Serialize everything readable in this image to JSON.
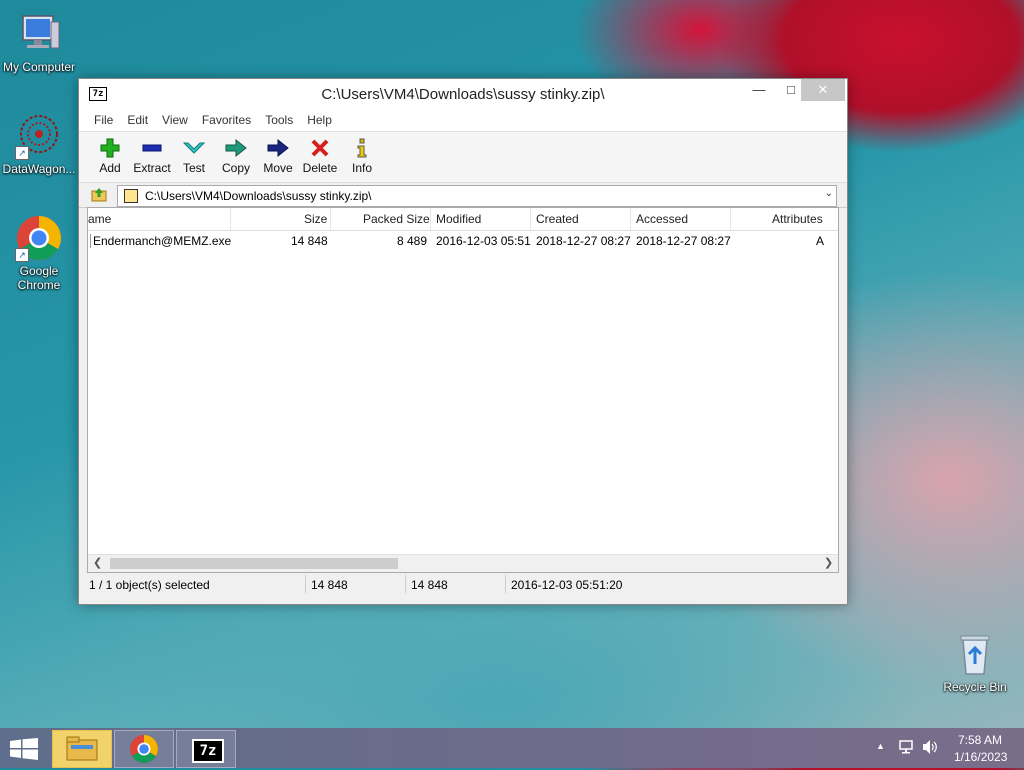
{
  "desktop": {
    "icons": [
      {
        "label": "My Computer"
      },
      {
        "label": "DataWagon..."
      },
      {
        "label": "Google Chrome"
      },
      {
        "label": "Recycle Bin"
      }
    ]
  },
  "window": {
    "title": "C:\\Users\\VM4\\Downloads\\sussy stinky.zip\\",
    "app_icon_text": "7z",
    "min_glyph": "—",
    "max_glyph": "□",
    "close_glyph": "✕",
    "menu": [
      "File",
      "Edit",
      "View",
      "Favorites",
      "Tools",
      "Help"
    ],
    "toolbar": [
      {
        "label": "Add",
        "icon": "plus-icon"
      },
      {
        "label": "Extract",
        "icon": "minus-icon"
      },
      {
        "label": "Test",
        "icon": "check-down-icon"
      },
      {
        "label": "Copy",
        "icon": "arrow-right-icon"
      },
      {
        "label": "Move",
        "icon": "arrow-right-dark-icon"
      },
      {
        "label": "Delete",
        "icon": "x-icon"
      },
      {
        "label": "Info",
        "icon": "info-icon"
      }
    ],
    "address": "C:\\Users\\VM4\\Downloads\\sussy stinky.zip\\",
    "columns": [
      "ame",
      "Size",
      "Packed Size",
      "Modified",
      "Created",
      "Accessed",
      "Attributes"
    ],
    "rows": [
      {
        "name": "Endermanch@MEMZ.exe",
        "size": "14 848",
        "packed": "8 489",
        "modified": "2016-12-03 05:51",
        "created": "2018-12-27 08:27",
        "accessed": "2018-12-27 08:27",
        "attributes": "A"
      }
    ],
    "status": {
      "selected": "1 / 1 object(s) selected",
      "size": "14 848",
      "packed": "14 848",
      "modified": "2016-12-03 05:51:20"
    }
  },
  "taskbar": {
    "items": [
      "file-explorer",
      "google-chrome",
      "7-zip"
    ],
    "active": "file-explorer",
    "time": "7:58 AM",
    "date": "1/16/2023",
    "sevenzip_text": "7z"
  }
}
